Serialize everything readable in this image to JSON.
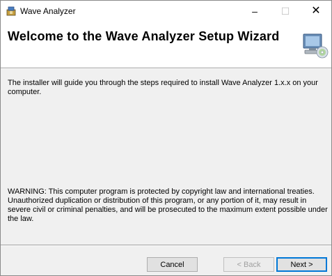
{
  "window": {
    "title": "Wave Analyzer",
    "controls": {
      "minimize": "–",
      "maximize": "☐",
      "close": "✕"
    }
  },
  "header": {
    "title": "Welcome to the Wave Analyzer Setup Wizard",
    "icon": "computer-cd-icon"
  },
  "content": {
    "intro": "The installer will guide you through the steps required to install Wave Analyzer 1.x.x on your computer.",
    "warning": "WARNING: This computer program is protected by copyright law and international treaties. Unauthorized duplication or distribution of this program, or any portion of it, may result in severe civil or criminal penalties, and will be prosecuted to the maximum extent possible under the law."
  },
  "buttons": {
    "cancel": "Cancel",
    "back": "< Back",
    "next": "Next >"
  }
}
